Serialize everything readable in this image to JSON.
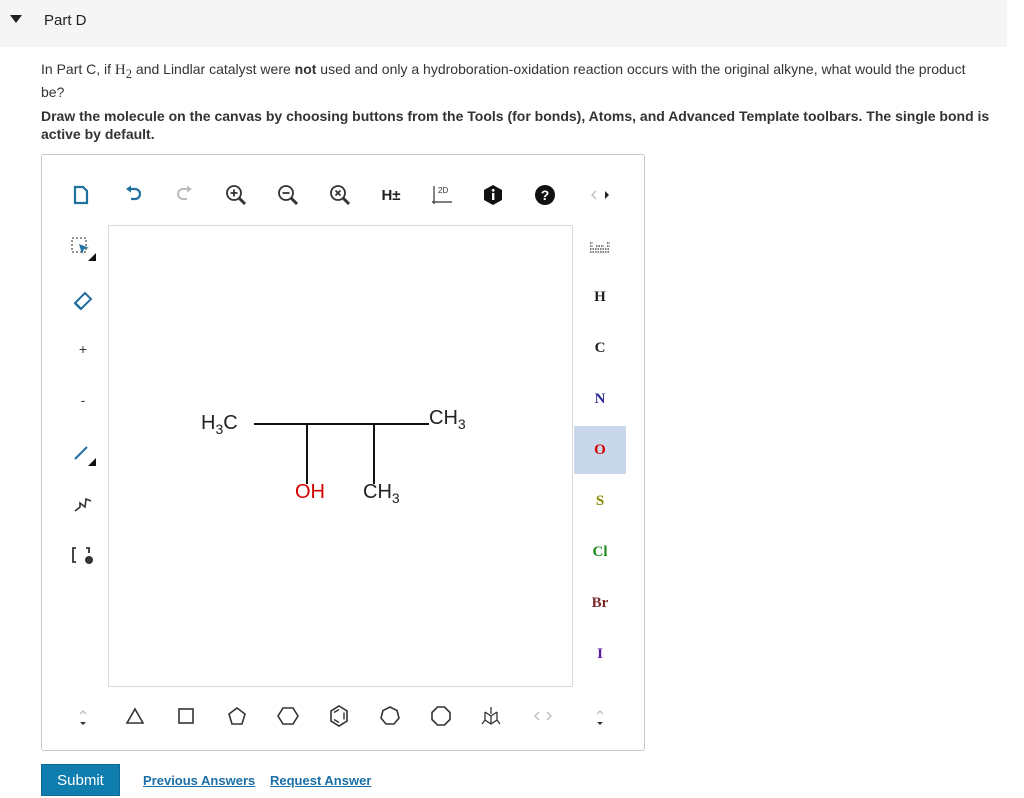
{
  "part": {
    "title": "Part D"
  },
  "question": {
    "t1": "In Part C, if ",
    "h2": "H",
    "h2_sub": "2",
    "t2": " and Lindlar catalyst were ",
    "not": "not",
    "t3": " used and only a hydroboration-oxidation reaction occurs with the original alkyne, what would the product be?"
  },
  "instructions": "Draw the molecule on the canvas by choosing buttons from the Tools (for bonds), Atoms, and Advanced Template toolbars. The single bond is active by default.",
  "toolbar": {
    "h_toggle": "H±",
    "two_d": "2D",
    "icons": [
      "clear-icon",
      "undo-icon",
      "redo-icon",
      "zoom-in-icon",
      "zoom-out-icon",
      "zoom-reset-icon",
      "hydrogen-toggle",
      "clean-2d-icon",
      "info-icon",
      "help-icon",
      "nav-arrows"
    ]
  },
  "left_tools": {
    "plus": "+",
    "minus": "-"
  },
  "atoms": [
    "H",
    "C",
    "N",
    "O",
    "S",
    "Cl",
    "Br",
    "I"
  ],
  "atom_colors": {
    "H": "#222222",
    "C": "#222222",
    "N": "#2a2a9a",
    "O": "#d40000",
    "S": "#8a8a00",
    "Cl": "#1a8a1a",
    "Br": "#7a2a2a",
    "I": "#5a1aa0"
  },
  "active_atom": "O",
  "molecule": {
    "left_label": "H",
    "left_sub": "3",
    "left_c": "C",
    "right_label": "CH",
    "right_sub": "3",
    "oh_label": "OH",
    "ch3_bottom": "CH",
    "ch3_bottom_sub": "3"
  },
  "actions": {
    "submit": "Submit",
    "previous": "Previous Answers",
    "request": "Request Answer"
  },
  "colors": {
    "accent": "#0f7eaf",
    "link": "#1a6fa8",
    "active_atom_bg": "#c9d7ea"
  }
}
